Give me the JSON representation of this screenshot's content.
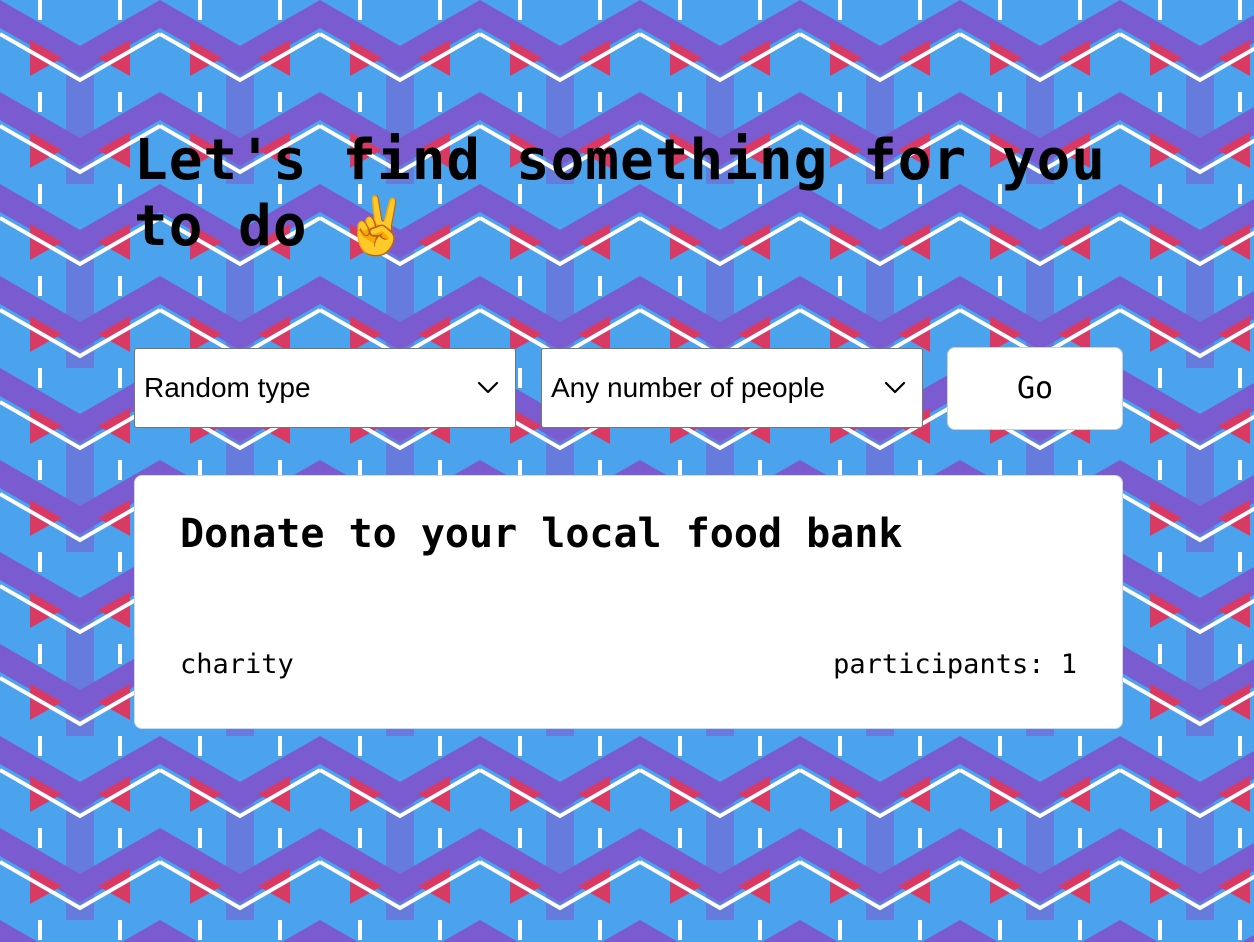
{
  "headline": "Let's find something for you to do ✌️",
  "filters": {
    "type_selected": "Random type",
    "people_selected": "Any number of people"
  },
  "go_label": "Go",
  "activity": {
    "title": "Donate to your local food bank",
    "type": "charity",
    "participants_label": "participants:",
    "participants_value": "1"
  },
  "icons": {
    "dropdown": "chevron-down-icon"
  },
  "colors": {
    "pattern_blue": "#4aa3ec",
    "pattern_purple": "#7b5bd0",
    "pattern_red": "#d83a63",
    "pattern_line": "#ffffff",
    "card_background": "#ffffff"
  }
}
